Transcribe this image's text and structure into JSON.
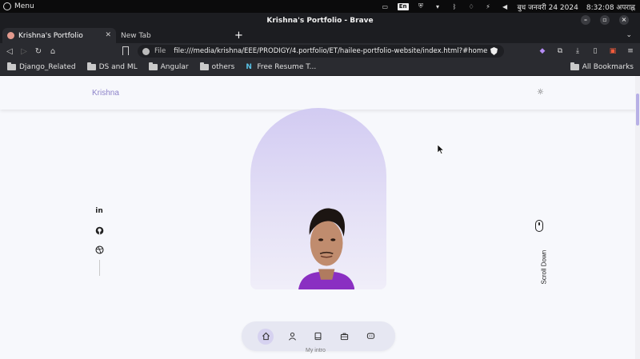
{
  "os_bar": {
    "menu_label": "Menu",
    "keyboard_layout": "En",
    "date": "बुध जनवरी 24 2024",
    "time": "8:32:08 अपराह्न"
  },
  "window": {
    "title": "Krishna's Portfolio - Brave"
  },
  "tabs": [
    {
      "label": "Krishna's Portfolio",
      "active": true
    },
    {
      "label": "New Tab",
      "active": false
    }
  ],
  "toolbar": {
    "url_scheme": "File",
    "url": "file:///media/krishna/EEE/PRODIGY/4.portfolio/ET/hailee-portfolio-website/index.html?#home"
  },
  "bookmarks": {
    "items": [
      {
        "label": "Django_Related",
        "icon": "folder-icon"
      },
      {
        "label": "DS and ML",
        "icon": "folder-icon"
      },
      {
        "label": "Angular",
        "icon": "folder-icon"
      },
      {
        "label": "others",
        "icon": "folder-icon"
      },
      {
        "label": "Free Resume T...",
        "icon": "notion-icon"
      }
    ],
    "all_label": "All Bookmarks"
  },
  "site": {
    "brand": "Krishna",
    "scroll_label": "Scroll Down",
    "section_label": "My intro",
    "accent": "#8d83c9",
    "arch_color": "#d2cbf2",
    "social": [
      "linkedin-icon",
      "github-icon",
      "dribbble-icon"
    ],
    "nav": [
      "home-icon",
      "user-icon",
      "book-icon",
      "briefcase-icon",
      "chat-icon"
    ],
    "active_nav": "home-icon"
  }
}
